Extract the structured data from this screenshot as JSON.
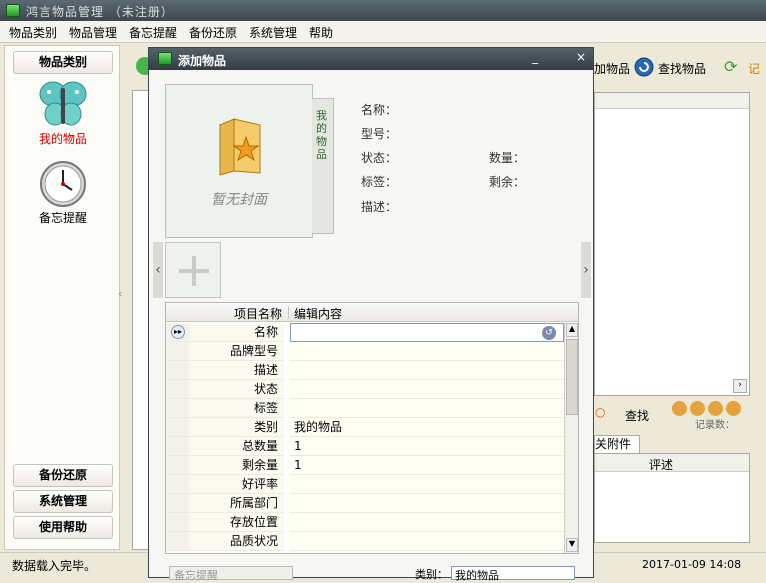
{
  "window": {
    "title": "鸿言物品管理 （未注册）"
  },
  "menu": [
    "物品类别",
    "物品管理",
    "备忘提醒",
    "备份还原",
    "系统管理",
    "帮助"
  ],
  "left_panel": {
    "category_button": "物品类别",
    "nav": [
      {
        "label": "我的物品",
        "icon": "butterfly-icon",
        "active": true
      },
      {
        "label": "备忘提醒",
        "icon": "clock-icon",
        "active": false
      }
    ],
    "bottom_buttons": [
      "备份还原",
      "系统管理",
      "使用帮助"
    ]
  },
  "background": {
    "toolbar_partial_add": "加物品",
    "toolbar_find": "查找物品",
    "toolbar_partial_record": "记",
    "search_button": "查找",
    "records_partial": "记录数：",
    "attachments_tab_partial": "关附件",
    "review_column": "评述",
    "timestamp": "2017-01-09 14:08"
  },
  "status": {
    "text": "数据载入完毕。"
  },
  "dialog": {
    "title": "添加物品",
    "cover_placeholder": "暂无封面",
    "cover_tab_label": "我的物品",
    "info_labels": {
      "name": "名称：",
      "model": "型号：",
      "state": "状态：",
      "tag": "标签：",
      "desc": "描述：",
      "quantity": "数量：",
      "remaining": "剩余："
    },
    "grid": {
      "headers": [
        "项目名称",
        "编辑内容"
      ],
      "rows": [
        {
          "name": "名称",
          "value": ""
        },
        {
          "name": "品牌型号",
          "value": ""
        },
        {
          "name": "描述",
          "value": ""
        },
        {
          "name": "状态",
          "value": ""
        },
        {
          "name": "标签",
          "value": ""
        },
        {
          "name": "类别",
          "value": "我的物品"
        },
        {
          "name": "总数量",
          "value": "1"
        },
        {
          "name": "剩余量",
          "value": "1"
        },
        {
          "name": "好评率",
          "value": ""
        },
        {
          "name": "所属部门",
          "value": ""
        },
        {
          "name": "存放位置",
          "value": ""
        },
        {
          "name": "品质状况",
          "value": ""
        }
      ]
    },
    "bottom": {
      "reminder_select": "备忘提醒",
      "category_label": "类别：",
      "category_value": "我的物品"
    }
  },
  "colors": {
    "accent_red": "#cc0000",
    "title_bar": "#3c464d",
    "grid_row_bg": "#fffff4"
  }
}
